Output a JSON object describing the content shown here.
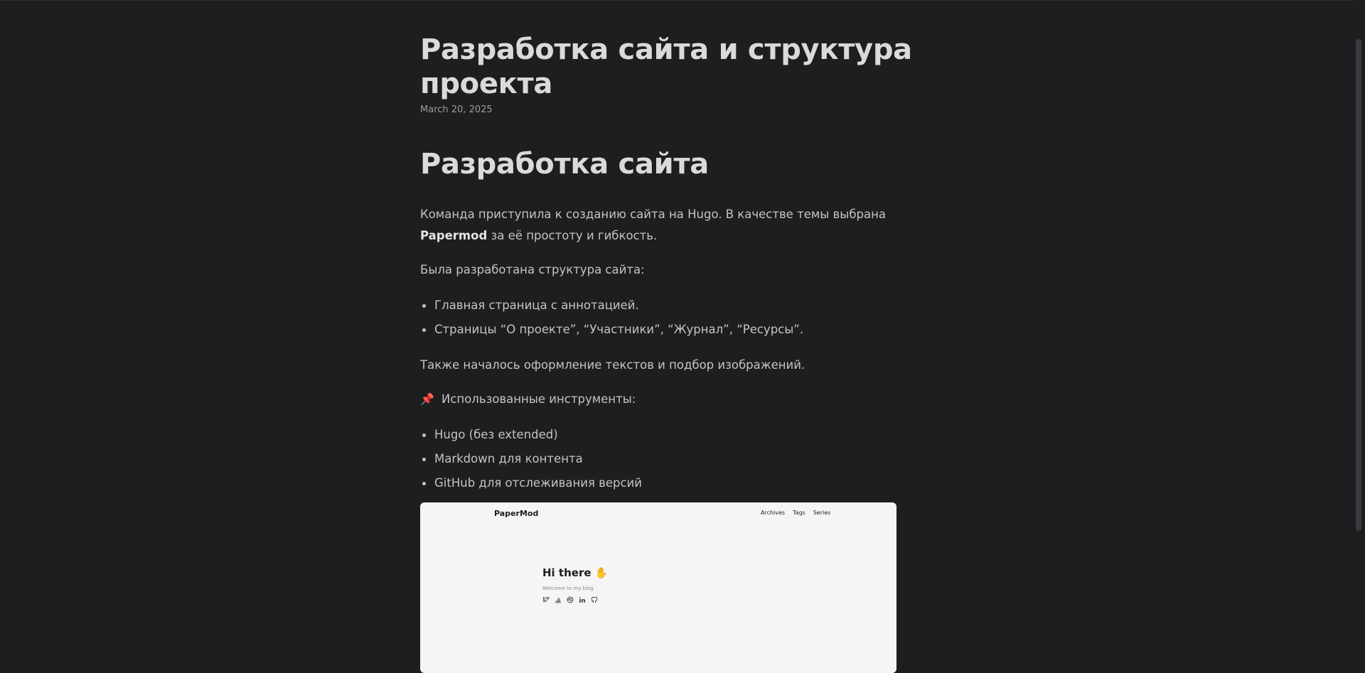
{
  "post": {
    "title": "Разработка сайта и структура проекта",
    "date": "March 20, 2025"
  },
  "content": {
    "heading": "Разработка сайта",
    "intro_before_bold": "Команда приступила к созданию сайта на Hugo. В качестве темы выбрана ",
    "intro_bold": "Papermod",
    "intro_after_bold": " за её простоту и гибкость.",
    "structure_label": "Была разработана структура сайта:",
    "structure_items": [
      "Главная страница с аннотацией.",
      "Страницы “О проекте”, “Участники”, “Журнал”, “Ресурсы”."
    ],
    "also": "Также началось оформление текстов и подбор изображений.",
    "tools_icon": "pushpin-icon",
    "tools_label": "Использованные инструменты:",
    "tools_items": [
      "Hugo (без extended)",
      "Markdown для контента",
      "GitHub для отслеживания версий"
    ]
  },
  "screenshot": {
    "logo": "PaperMod",
    "nav": [
      "Archives",
      "Tags",
      "Series"
    ],
    "greeting": "Hi there",
    "greeting_icon": "waving-hand-icon",
    "subtitle": "Welcome to my blog",
    "social_icons": [
      "twitter-icon",
      "stackoverflow-icon",
      "dribbble-icon",
      "linkedin-icon",
      "github-icon"
    ]
  }
}
